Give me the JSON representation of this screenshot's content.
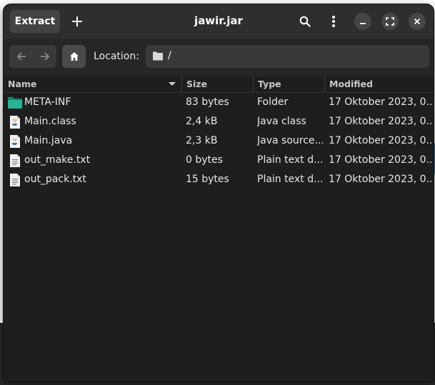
{
  "window": {
    "title": "jawir.jar"
  },
  "headerbar": {
    "extract_label": "Extract",
    "new_icon": "plus-icon",
    "search_icon": "search-icon",
    "menu_icon": "vertical-dots-icon",
    "minimize_icon": "minimize-icon",
    "maximize_icon": "maximize-icon",
    "close_icon": "close-icon"
  },
  "location": {
    "back_icon": "arrow-left-icon",
    "forward_icon": "arrow-right-icon",
    "home_icon": "home-icon",
    "label": "Location:",
    "path": "/"
  },
  "columns": [
    "Name",
    "Size",
    "Type",
    "Modified"
  ],
  "files": [
    {
      "name": "META-INF",
      "size": "83 bytes",
      "type": "Folder",
      "modified": "17 Oktober 2023, 0...",
      "icon": "folder-icon"
    },
    {
      "name": "Main.class",
      "size": "2,4 kB",
      "type": "Java class",
      "modified": "17 Oktober 2023, 0...",
      "icon": "java-file-icon"
    },
    {
      "name": "Main.java",
      "size": "2,3 kB",
      "type": "Java source...",
      "modified": "17 Oktober 2023, 0...",
      "icon": "java-file-icon"
    },
    {
      "name": "out_make.txt",
      "size": "0 bytes",
      "type": "Plain text d...",
      "modified": "17 Oktober 2023, 0...",
      "icon": "text-file-icon"
    },
    {
      "name": "out_pack.txt",
      "size": "15 bytes",
      "type": "Plain text d...",
      "modified": "17 Oktober 2023, 0...",
      "icon": "text-file-icon"
    }
  ],
  "colors": {
    "window_bg": "#1e1e1e",
    "headerbar_bg": "#2e2e2e",
    "folder_accent": "#1aa08a"
  }
}
